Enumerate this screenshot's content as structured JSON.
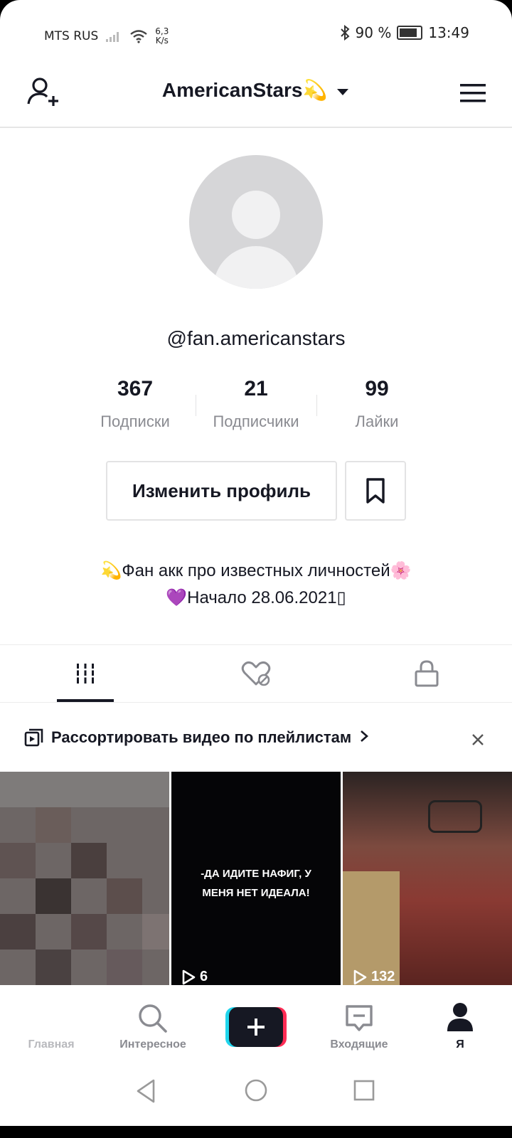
{
  "status_bar": {
    "carrier": "MTS RUS",
    "speed_value": "6,3",
    "speed_unit": "K/s",
    "battery": "90 %",
    "time": "13:49"
  },
  "header": {
    "title": "AmericanStars💫"
  },
  "profile": {
    "username": "@fan.americanstars",
    "stats": [
      {
        "value": "367",
        "label": "Подписки"
      },
      {
        "value": "21",
        "label": "Подписчики"
      },
      {
        "value": "99",
        "label": "Лайки"
      }
    ],
    "edit_button": "Изменить профиль",
    "bio_line1": "💫Фан акк про известных личностей🌸",
    "bio_line2": "💜Начало 28.06.2021▯"
  },
  "tabs": {
    "items": [
      "videos-grid-icon",
      "liked-videos-icon",
      "private-lock-icon"
    ],
    "active": 0
  },
  "playlist_banner": {
    "text": "Рассортировать видео по плейлистам"
  },
  "videos": [
    {
      "views": "",
      "caption": ""
    },
    {
      "views": "6",
      "caption": "-ДА ИДИТЕ НАФИГ, У МЕНЯ НЕТ ИДЕАЛА!"
    },
    {
      "views": "132",
      "caption": ""
    }
  ],
  "bottom_nav": {
    "items": [
      {
        "label": "Главная",
        "icon": "home-icon"
      },
      {
        "label": "Интересное",
        "icon": "search-icon"
      },
      {
        "label": "",
        "icon": "create-plus-icon"
      },
      {
        "label": "Входящие",
        "icon": "inbox-icon"
      },
      {
        "label": "Я",
        "icon": "profile-icon"
      }
    ],
    "active": 4
  },
  "colors": {
    "text_primary": "#161823",
    "text_secondary": "#8a8b91",
    "divider": "#e3e3e4",
    "accent_cyan": "#20d5ec",
    "accent_red": "#fe2c55"
  }
}
